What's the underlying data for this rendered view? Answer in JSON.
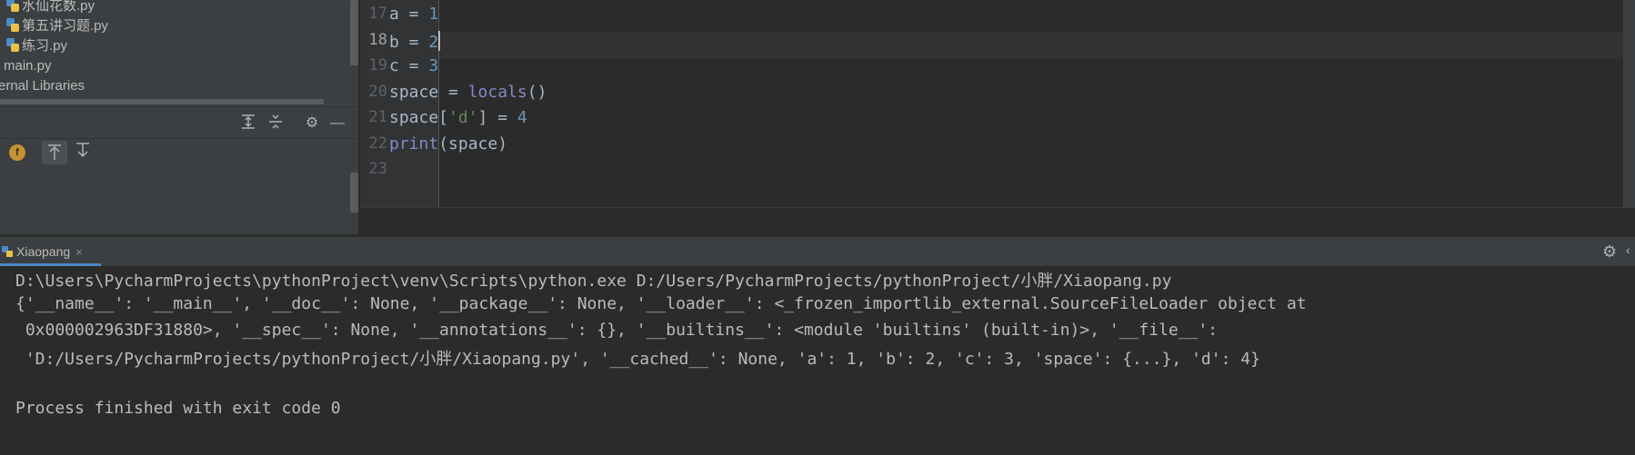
{
  "project_tree": {
    "items": [
      {
        "label": "水仙花数.py"
      },
      {
        "label": "第五讲习题.py"
      },
      {
        "label": "练习.py"
      },
      {
        "label": "main.py"
      },
      {
        "label": "ernal Libraries"
      }
    ]
  },
  "structure_toolbar": {
    "icons": [
      "expand-all-icon",
      "collapse-all-icon",
      "gear-icon",
      "minimize-icon"
    ]
  },
  "sort_toolbar": {
    "badge": "f",
    "icons": [
      "fields-icon",
      "navigate-from-source-icon",
      "navigate-to-source-icon"
    ]
  },
  "editor": {
    "active_line": 18,
    "lines": [
      {
        "num": "17",
        "tokens": [
          {
            "t": "a = ",
            "c": "plain"
          },
          {
            "t": "1",
            "c": "num"
          }
        ]
      },
      {
        "num": "18",
        "tokens": [
          {
            "t": "b = ",
            "c": "plain"
          },
          {
            "t": "2",
            "c": "num"
          }
        ]
      },
      {
        "num": "19",
        "tokens": [
          {
            "t": "c = ",
            "c": "plain"
          },
          {
            "t": "3",
            "c": "num"
          }
        ]
      },
      {
        "num": "20",
        "tokens": [
          {
            "t": "space = ",
            "c": "plain"
          },
          {
            "t": "locals",
            "c": "fn"
          },
          {
            "t": "()",
            "c": "plain"
          }
        ]
      },
      {
        "num": "21",
        "tokens": [
          {
            "t": "space[",
            "c": "plain"
          },
          {
            "t": "'d'",
            "c": "str"
          },
          {
            "t": "] = ",
            "c": "plain"
          },
          {
            "t": "4",
            "c": "num"
          }
        ]
      },
      {
        "num": "22",
        "tokens": [
          {
            "t": "print",
            "c": "fn"
          },
          {
            "t": "(space)",
            "c": "plain"
          }
        ]
      },
      {
        "num": "23",
        "tokens": []
      }
    ]
  },
  "run_panel": {
    "tab_label": "Xiaopang",
    "close_glyph": "×",
    "colors": {
      "tab_underline": "#4a88c7"
    }
  },
  "console": {
    "lines": [
      "D:\\Users\\PycharmProjects\\pythonProject\\venv\\Scripts\\python.exe D:/Users/PycharmProjects/pythonProject/小胖/Xiaopang.py",
      "{'__name__': '__main__', '__doc__': None, '__package__': None, '__loader__': <_frozen_importlib_external.SourceFileLoader object at",
      " 0x000002963DF31880>, '__spec__': None, '__annotations__': {}, '__builtins__': <module 'builtins' (built-in)>, '__file__':",
      " 'D:/Users/PycharmProjects/pythonProject/小胖/Xiaopang.py', '__cached__': None, 'a': 1, 'b': 2, 'c': 3, 'space': {...}, 'd': 4}",
      "",
      "Process finished with exit code 0"
    ]
  }
}
